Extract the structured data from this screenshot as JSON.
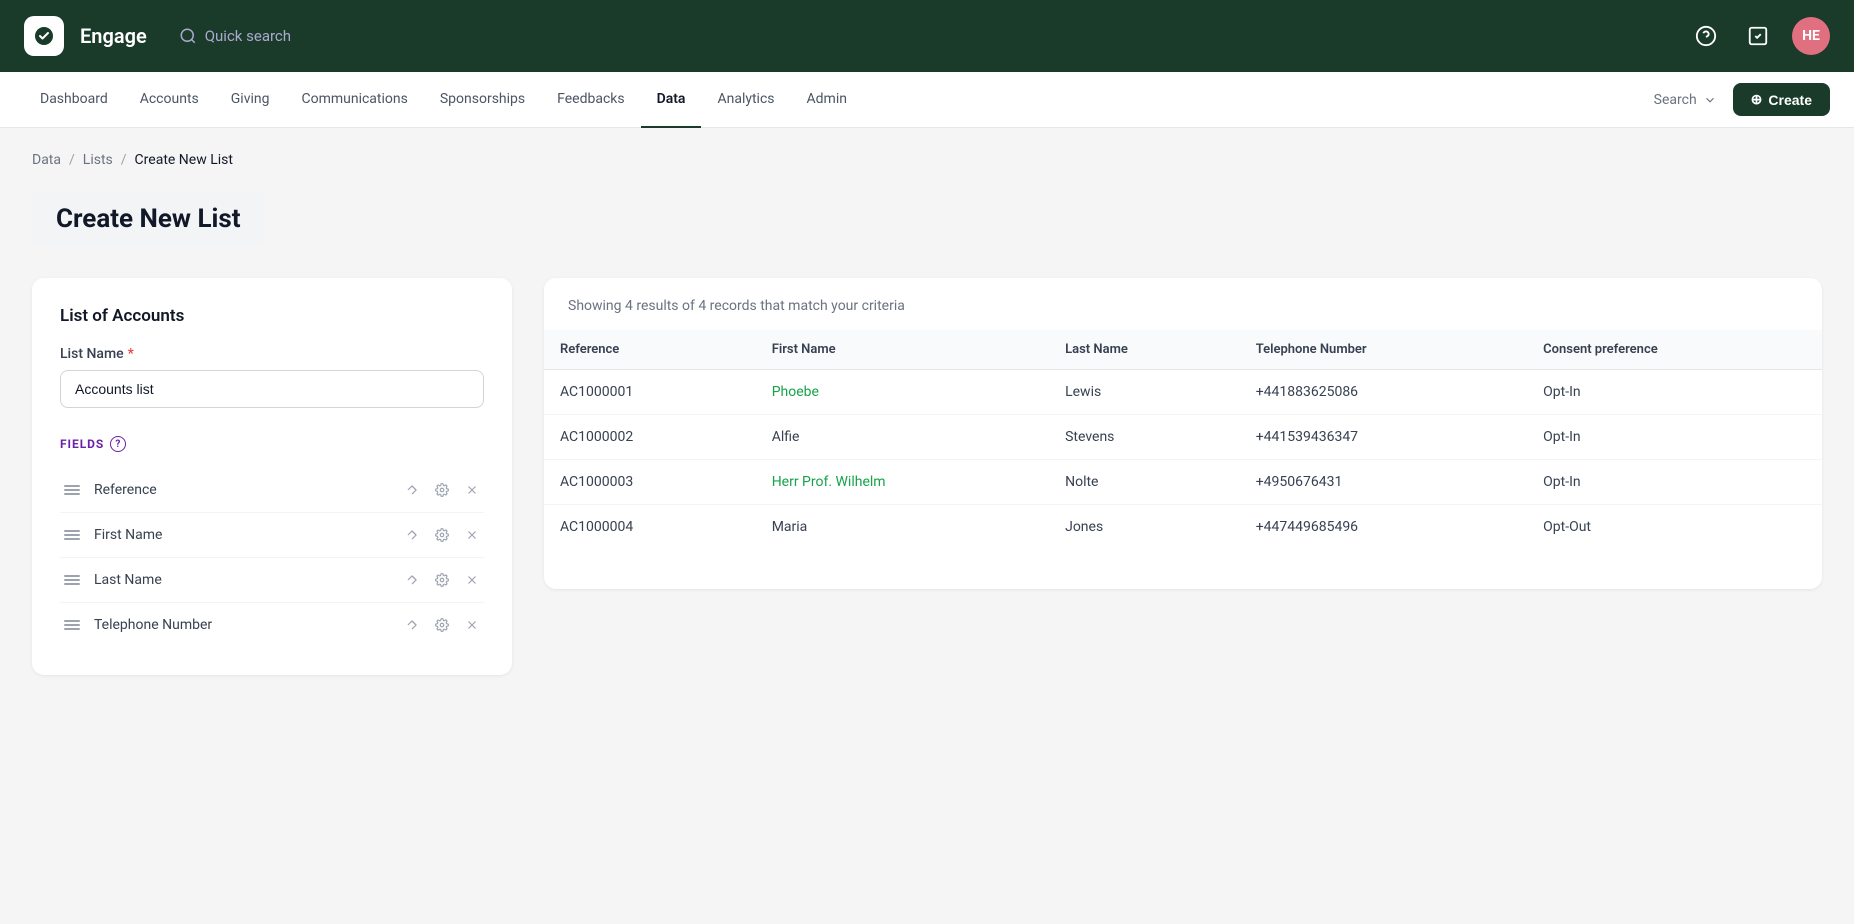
{
  "app": {
    "name": "Engage",
    "avatar_initials": "HE"
  },
  "topbar": {
    "quick_search_label": "Quick search"
  },
  "nav": {
    "items": [
      {
        "id": "dashboard",
        "label": "Dashboard",
        "active": false
      },
      {
        "id": "accounts",
        "label": "Accounts",
        "active": false
      },
      {
        "id": "giving",
        "label": "Giving",
        "active": false
      },
      {
        "id": "communications",
        "label": "Communications",
        "active": false
      },
      {
        "id": "sponsorships",
        "label": "Sponsorships",
        "active": false
      },
      {
        "id": "feedbacks",
        "label": "Feedbacks",
        "active": false
      },
      {
        "id": "data",
        "label": "Data",
        "active": true
      },
      {
        "id": "analytics",
        "label": "Analytics",
        "active": false
      },
      {
        "id": "admin",
        "label": "Admin",
        "active": false
      }
    ],
    "search_label": "Search",
    "create_label": "Create"
  },
  "breadcrumb": {
    "items": [
      {
        "label": "Data",
        "link": true
      },
      {
        "label": "Lists",
        "link": true
      },
      {
        "label": "Create New List",
        "link": false
      }
    ]
  },
  "page": {
    "title": "Create New List"
  },
  "left_panel": {
    "section_title": "List of Accounts",
    "list_name_label": "List Name",
    "list_name_required": true,
    "list_name_value": "Accounts list",
    "list_name_placeholder": "Accounts list",
    "fields_label": "FIELDS",
    "fields": [
      {
        "id": "reference",
        "name": "Reference"
      },
      {
        "id": "first-name",
        "name": "First Name"
      },
      {
        "id": "last-name",
        "name": "Last Name"
      },
      {
        "id": "telephone-number",
        "name": "Telephone Number"
      }
    ]
  },
  "results": {
    "summary": "Showing 4 results of 4 records that match your criteria",
    "columns": [
      "Reference",
      "First Name",
      "Last Name",
      "Telephone Number",
      "Consent preference"
    ],
    "rows": [
      {
        "reference": "AC1000001",
        "first_name": "Phoebe",
        "last_name": "Lewis",
        "telephone": "+441883625086",
        "consent": "Opt-In",
        "first_name_linked": true
      },
      {
        "reference": "AC1000002",
        "first_name": "Alfie",
        "last_name": "Stevens",
        "telephone": "+441539436347",
        "consent": "Opt-In",
        "first_name_linked": false
      },
      {
        "reference": "AC1000003",
        "first_name": "Herr Prof. Wilhelm",
        "last_name": "Nolte",
        "telephone": "+4950676431",
        "consent": "Opt-In",
        "first_name_linked": true
      },
      {
        "reference": "AC1000004",
        "first_name": "Maria",
        "last_name": "Jones",
        "telephone": "+447449685496",
        "consent": "Opt-Out",
        "first_name_linked": false
      }
    ]
  }
}
